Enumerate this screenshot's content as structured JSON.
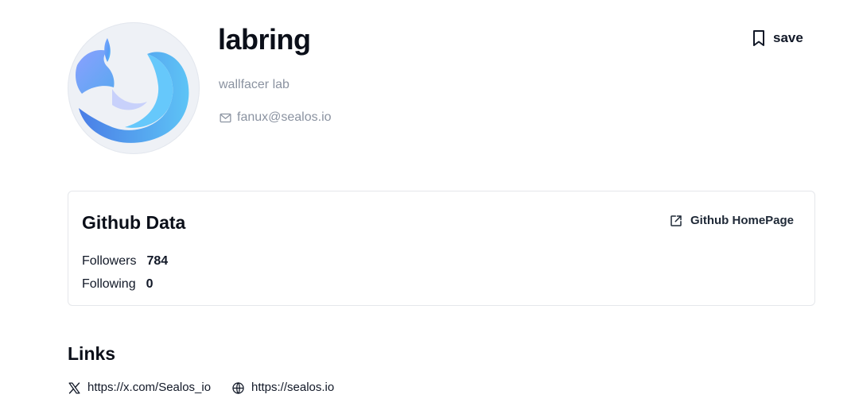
{
  "profile": {
    "name": "labring",
    "organization": "wallfacer lab",
    "email": "fanux@sealos.io",
    "avatar_colors": [
      "#5b8def",
      "#4fc3f7",
      "#a78bfa"
    ]
  },
  "actions": {
    "save_label": "save"
  },
  "github": {
    "title": "Github Data",
    "homepage_label": "Github HomePage",
    "stats": [
      {
        "label": "Followers",
        "value": "784"
      },
      {
        "label": "Following",
        "value": "0"
      }
    ]
  },
  "links": {
    "heading": "Links",
    "items": [
      {
        "icon": "x-logo-icon",
        "url": "https://x.com/Sealos_io"
      },
      {
        "icon": "globe-icon",
        "url": "https://sealos.io"
      }
    ]
  }
}
